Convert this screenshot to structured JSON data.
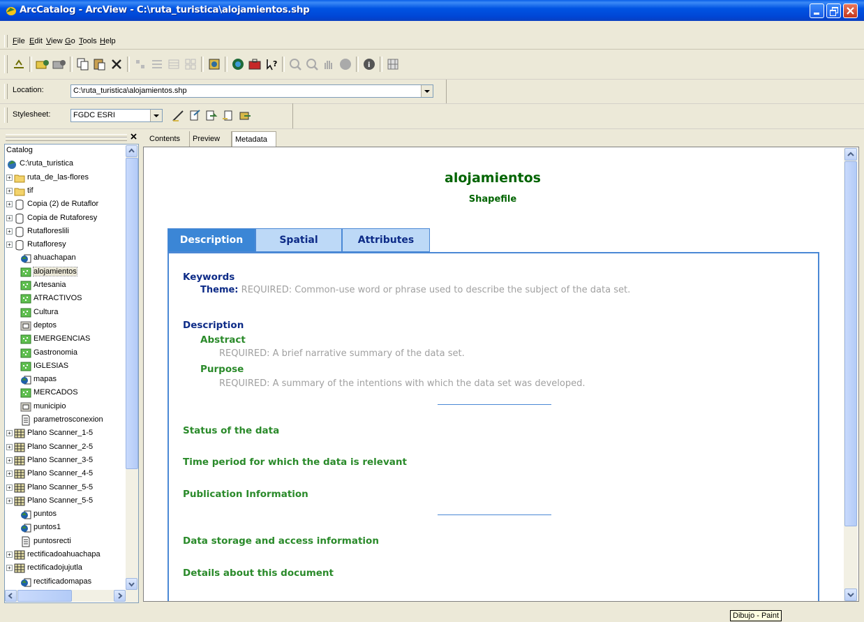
{
  "window": {
    "title": "ArcCatalog - ArcView - C:\\ruta_turistica\\alojamientos.shp"
  },
  "menu": [
    "File",
    "Edit",
    "View",
    "Go",
    "Tools",
    "Help"
  ],
  "location": {
    "label": "Location:",
    "value": "C:\\ruta_turistica\\alojamientos.shp"
  },
  "stylesheet": {
    "label": "Stylesheet:",
    "value": "FGDC ESRI"
  },
  "catalog": {
    "header": "Catalog",
    "items": [
      {
        "label": "C:\\ruta_turistica",
        "icon": "drive-folder-icon",
        "expander": "",
        "indent": 0
      },
      {
        "label": "ruta_de_las-flores",
        "icon": "folder-icon",
        "expander": "+",
        "indent": 1
      },
      {
        "label": "tif",
        "icon": "folder-icon",
        "expander": "+",
        "indent": 1
      },
      {
        "label": "Copia (2) de Rutaflor",
        "icon": "database-icon",
        "expander": "+",
        "indent": 1
      },
      {
        "label": "Copia de Rutaforesy",
        "icon": "database-icon",
        "expander": "+",
        "indent": 1
      },
      {
        "label": "Rutafloreslili",
        "icon": "database-icon",
        "expander": "+",
        "indent": 1
      },
      {
        "label": "Rutafloresy",
        "icon": "database-icon",
        "expander": "+",
        "indent": 1
      },
      {
        "label": "ahuachapan",
        "icon": "globe-layer-icon",
        "expander": "",
        "indent": 2
      },
      {
        "label": "alojamientos",
        "icon": "point-shapefile-icon",
        "expander": "",
        "indent": 2
      },
      {
        "label": "Artesania",
        "icon": "point-shapefile-icon",
        "expander": "",
        "indent": 2
      },
      {
        "label": "ATRACTIVOS",
        "icon": "point-shapefile-icon",
        "expander": "",
        "indent": 2
      },
      {
        "label": "Cultura",
        "icon": "point-shapefile-icon",
        "expander": "",
        "indent": 2
      },
      {
        "label": "deptos",
        "icon": "polygon-shapefile-icon",
        "expander": "",
        "indent": 2
      },
      {
        "label": "EMERGENCIAS",
        "icon": "point-shapefile-icon",
        "expander": "",
        "indent": 2
      },
      {
        "label": "Gastronomia",
        "icon": "point-shapefile-icon",
        "expander": "",
        "indent": 2
      },
      {
        "label": "IGLESIAS",
        "icon": "point-shapefile-icon",
        "expander": "",
        "indent": 2
      },
      {
        "label": "mapas",
        "icon": "globe-layer-icon",
        "expander": "",
        "indent": 2
      },
      {
        "label": "MERCADOS",
        "icon": "point-shapefile-icon",
        "expander": "",
        "indent": 2
      },
      {
        "label": "municipio",
        "icon": "polygon-shapefile-icon",
        "expander": "",
        "indent": 2
      },
      {
        "label": "parametrosconexion",
        "icon": "text-file-icon",
        "expander": "",
        "indent": 2
      },
      {
        "label": "Plano Scanner_1-5",
        "icon": "raster-icon",
        "expander": "+",
        "indent": 1
      },
      {
        "label": "Plano Scanner_2-5",
        "icon": "raster-icon",
        "expander": "+",
        "indent": 1
      },
      {
        "label": "Plano Scanner_3-5",
        "icon": "raster-icon",
        "expander": "+",
        "indent": 1
      },
      {
        "label": "Plano Scanner_4-5",
        "icon": "raster-icon",
        "expander": "+",
        "indent": 1
      },
      {
        "label": "Plano Scanner_5-5",
        "icon": "raster-icon",
        "expander": "+",
        "indent": 1
      },
      {
        "label": "Plano Scanner_5-5",
        "icon": "raster-icon",
        "expander": "+",
        "indent": 1
      },
      {
        "label": "puntos",
        "icon": "globe-layer-icon",
        "expander": "",
        "indent": 2
      },
      {
        "label": "puntos1",
        "icon": "globe-layer-icon",
        "expander": "",
        "indent": 2
      },
      {
        "label": "puntosrecti",
        "icon": "text-file-icon",
        "expander": "",
        "indent": 2
      },
      {
        "label": "rectificadoahuachapa",
        "icon": "raster-icon",
        "expander": "+",
        "indent": 1
      },
      {
        "label": "rectificadojujutla",
        "icon": "raster-icon",
        "expander": "+",
        "indent": 1
      },
      {
        "label": "rectificadomapas",
        "icon": "globe-layer-icon",
        "expander": "",
        "indent": 2
      }
    ],
    "selected_index": 8
  },
  "view_tabs": [
    "Contents",
    "Preview",
    "Metadata"
  ],
  "metadata": {
    "title": "alojamientos",
    "subtitle": "Shapefile",
    "tabs": [
      "Description",
      "Spatial",
      "Attributes"
    ],
    "keywords_heading": "Keywords",
    "theme_label": "Theme:",
    "theme_text": "REQUIRED: Common-use word or phrase used to describe the subject of the data set.",
    "description_heading": "Description",
    "abstract_heading": "Abstract",
    "abstract_text": "REQUIRED: A brief narrative summary of the data set.",
    "purpose_heading": "Purpose",
    "purpose_text": "REQUIRED: A summary of the intentions with which the data set was developed.",
    "sections": [
      "Status of the data",
      "Time period for which the data is relevant",
      "Publication Information",
      "Data storage and access information",
      "Details about this document"
    ]
  },
  "tooltip": "Dibujo - Paint",
  "colors": {
    "title_green": "#006400",
    "section_green": "#2a8a2a",
    "navy": "#0d2b87",
    "tab_blue": "#3b86d6"
  }
}
